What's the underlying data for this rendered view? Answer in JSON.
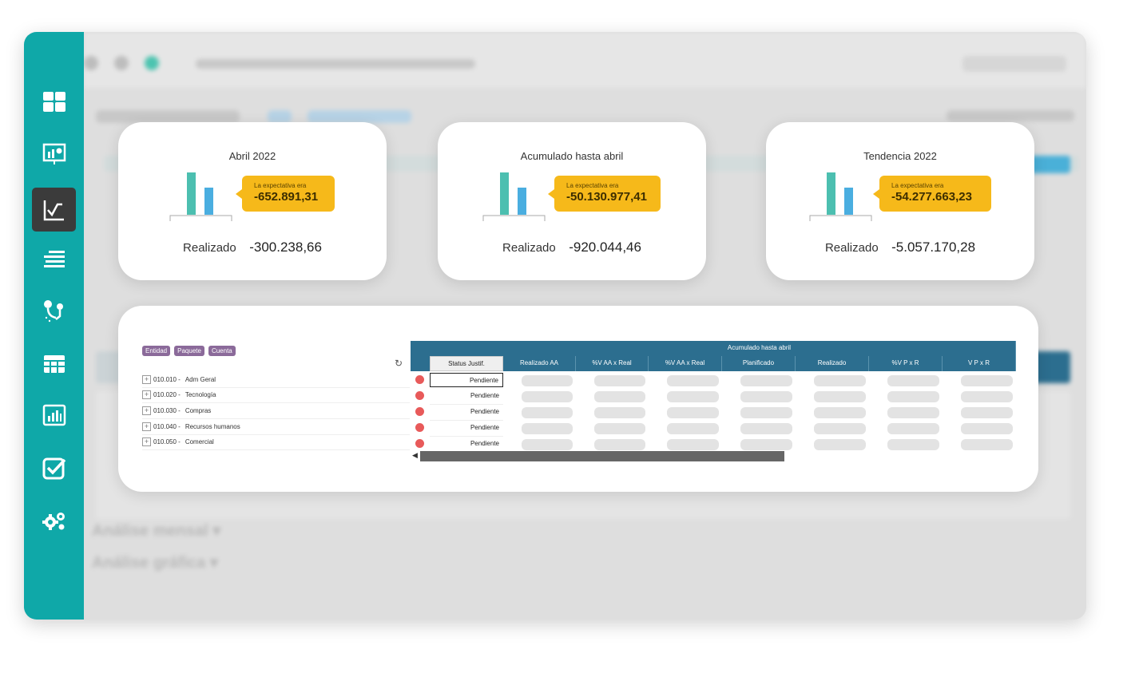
{
  "sidebar": {
    "items": [
      {
        "icon": "dashboard-icon"
      },
      {
        "icon": "presentation-chart-icon"
      },
      {
        "icon": "line-chart-icon",
        "active": true
      },
      {
        "icon": "list-lines-icon"
      },
      {
        "icon": "workflow-icon"
      },
      {
        "icon": "table-grid-icon"
      },
      {
        "icon": "bar-report-icon"
      },
      {
        "icon": "checkbox-icon"
      },
      {
        "icon": "settings-gears-icon"
      }
    ]
  },
  "kpis": [
    {
      "title": "Abril 2022",
      "bubble_label": "La expectativa era",
      "bubble_value": "-652.891,31",
      "realizado_label": "Realizado",
      "realizado_value": "-300.238,66"
    },
    {
      "title": "Acumulado hasta abril",
      "bubble_label": "La expectativa era",
      "bubble_value": "-50.130.977,41",
      "realizado_label": "Realizado",
      "realizado_value": "-920.044,46"
    },
    {
      "title": "Tendencia 2022",
      "bubble_label": "La expectativa era",
      "bubble_value": "-54.277.663,23",
      "realizado_label": "Realizado",
      "realizado_value": "-5.057.170,28"
    }
  ],
  "table": {
    "tags": [
      "Entidad",
      "Paquete",
      "Cuenta"
    ],
    "group_header": "Acumulado hasta abril",
    "status_header": "Status Justif.",
    "columns": [
      "Realizado AA",
      "%V AA x Real",
      "%V AA x Real",
      "Planificado",
      "Realizado",
      "%V P x R",
      "V P x R"
    ],
    "rows": [
      {
        "code": "010.010 -",
        "name": "Adm Geral",
        "status": "Pendiente"
      },
      {
        "code": "010.020 -",
        "name": "Tecnología",
        "status": "Pendiente"
      },
      {
        "code": "010.030 -",
        "name": "Compras",
        "status": "Pendiente"
      },
      {
        "code": "010.040 -",
        "name": "Recursos humanos",
        "status": "Pendiente"
      },
      {
        "code": "010.050 -",
        "name": "Comercial",
        "status": "Pendiente"
      }
    ]
  },
  "colors": {
    "sidebar": "#0fa8a8",
    "accent_yellow": "#f6b91a",
    "bar_teal": "#4cbfb0",
    "bar_blue": "#4aaee0",
    "header_blue": "#2c6e8f",
    "status_red": "#e85a5a",
    "tag_purple": "#8b6a9a"
  }
}
